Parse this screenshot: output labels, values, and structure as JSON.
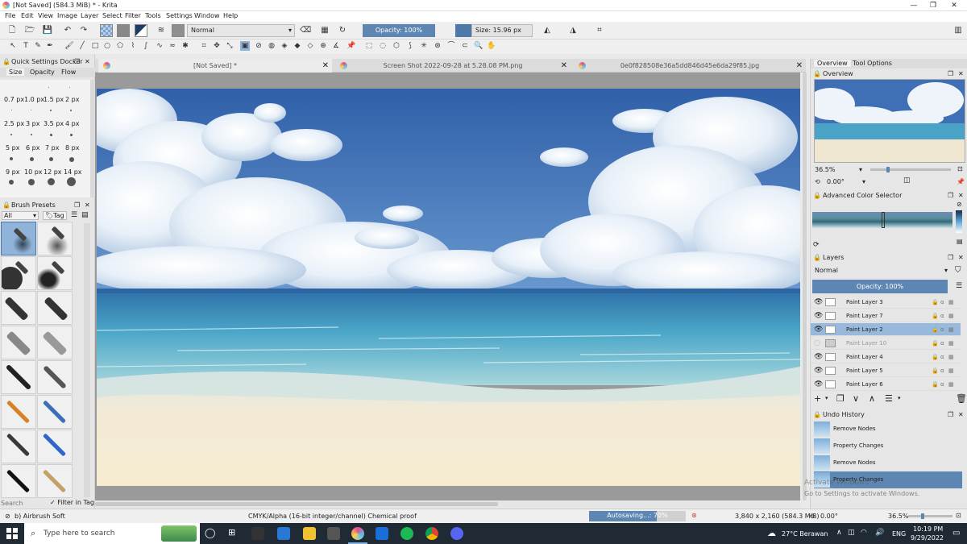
{
  "window": {
    "title": "[Not Saved]  (584.3 MiB)  * - Krita"
  },
  "menu": [
    "File",
    "Edit",
    "View",
    "Image",
    "Layer",
    "Select",
    "Filter",
    "Tools",
    "Settings",
    "Window",
    "Help"
  ],
  "toolbar": {
    "blend_mode": "Normal",
    "opacity": "Opacity: 100%",
    "size": "Size: 15.96 px"
  },
  "quick_settings": {
    "title": "Quick Settings Docker",
    "tabs": [
      "Size",
      "Opacity",
      "Flow"
    ],
    "sizes": [
      [
        "0.7 px",
        "1.0 px",
        "1.5 px",
        "2 px"
      ],
      [
        "2.5 px",
        "3 px",
        "3.5 px",
        "4 px"
      ],
      [
        "5 px",
        "6 px",
        "7 px",
        "8 px"
      ],
      [
        "9 px",
        "10 px",
        "12 px",
        "14 px"
      ]
    ]
  },
  "brush_presets": {
    "title": "Brush Presets",
    "filter": "All",
    "tag": "Tag",
    "search_placeholder": "Search",
    "filter_in_tag": "Filter in Tag"
  },
  "tabs": [
    {
      "label": "[Not Saved]  *"
    },
    {
      "label": "Screen Shot 2022-09-28 at 5.28.08 PM.png"
    },
    {
      "label": "0e0f828508e36a5dd846d45e6da29f85.jpg"
    }
  ],
  "right": {
    "tabs": [
      "Overview",
      "Tool Options"
    ],
    "overview": {
      "title": "Overview",
      "zoom": "36.5%",
      "rotation": "0.00°"
    },
    "color_selector": {
      "title": "Advanced Color Selector"
    },
    "layers": {
      "title": "Layers",
      "blend_mode": "Normal",
      "opacity": "Opacity:  100%",
      "items": [
        {
          "name": "Paint Layer 3"
        },
        {
          "name": "Paint Layer 7"
        },
        {
          "name": "Paint Layer 2"
        },
        {
          "name": "Paint Layer 10"
        },
        {
          "name": "Paint Layer 4"
        },
        {
          "name": "Paint Layer 5"
        },
        {
          "name": "Paint Layer 6"
        }
      ],
      "selected_index": 2,
      "hidden_index": 3
    },
    "undo": {
      "title": "Undo History",
      "items": [
        "Remove Nodes",
        "Property Changes",
        "Remove Nodes",
        "Property Changes"
      ],
      "selected_index": 3
    }
  },
  "watermark": {
    "line1": "Activate Windows",
    "line2": "Go to Settings to activate Windows."
  },
  "status": {
    "brush": "b) Airbrush Soft",
    "color_space": "CMYK/Alpha (16-bit integer/channel)  Chemical proof",
    "autosave": "Autosaving...: 70%",
    "autosave_progress": 0.7,
    "dimensions": "3,840 x 2,160 (584.3 MiB)",
    "rotation": "0.00°",
    "zoom": "36.5%"
  },
  "taskbar": {
    "search_placeholder": "Type here to search",
    "weather": "27°C  Berawan",
    "language": "ENG",
    "time": "10:19 PM",
    "date": "9/29/2022"
  }
}
